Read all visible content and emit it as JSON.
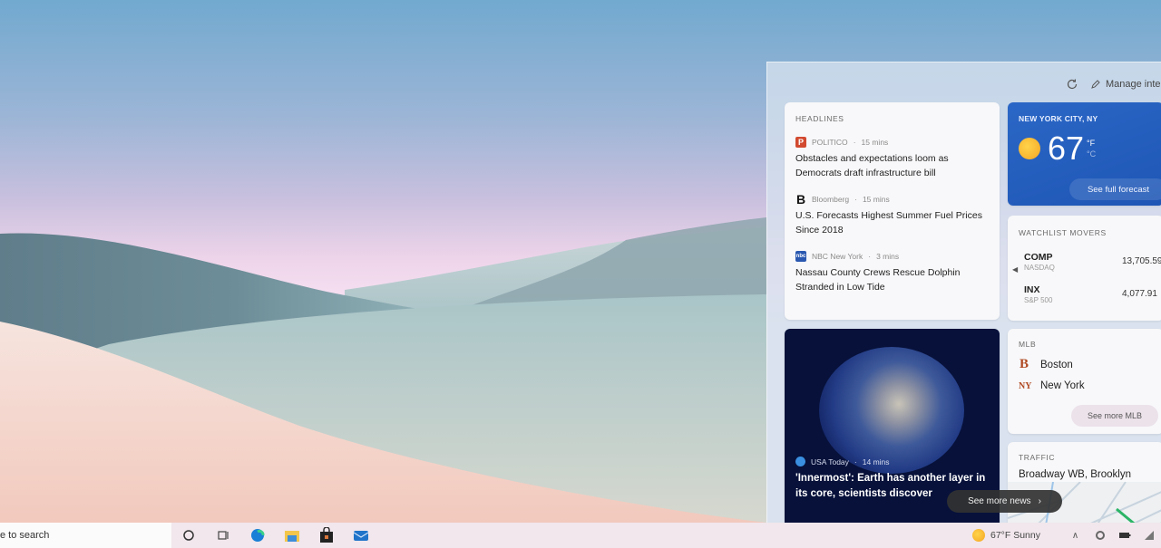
{
  "panel": {
    "manage_label": "Manage inte",
    "headlines": {
      "title": "HEADLINES",
      "items": [
        {
          "source": "POLITICO",
          "age": "15 mins",
          "logo": "P",
          "title": "Obstacles and expectations loom as Democrats draft infrastructure bill"
        },
        {
          "source": "Bloomberg",
          "age": "15 mins",
          "logo": "B",
          "title": "U.S. Forecasts Highest Summer Fuel Prices Since 2018"
        },
        {
          "source": "NBC New York",
          "age": "3 mins",
          "logo": "nbc",
          "title": "Nassau County Crews Rescue Dolphin Stranded in Low Tide"
        }
      ]
    },
    "weather": {
      "location": "NEW YORK CITY, NY",
      "temperature": "67",
      "unit_f": "°F",
      "unit_c": "°C",
      "forecast_label": "See full forecast"
    },
    "watchlist": {
      "title": "WATCHLIST MOVERS",
      "items": [
        {
          "symbol": "COMP",
          "exchange": "NASDAQ",
          "value": "13,705.59"
        },
        {
          "symbol": "INX",
          "exchange": "S&P 500",
          "value": "4,077.91"
        }
      ]
    },
    "news": {
      "source": "USA Today",
      "age": "14 mins",
      "title": "'Innermost': Earth has another layer in its core, scientists discover"
    },
    "mlb": {
      "title": "MLB",
      "teams": [
        {
          "name": "Boston",
          "logo": "B"
        },
        {
          "name": "New York",
          "logo": "NY"
        }
      ],
      "more_label": "See more MLB"
    },
    "traffic": {
      "title": "TRAFFIC",
      "location": "Broadway WB, Brooklyn"
    },
    "see_more_news": "See more news"
  },
  "taskbar": {
    "search_placeholder": "e to search",
    "weather_label": "67°F  Sunny"
  }
}
